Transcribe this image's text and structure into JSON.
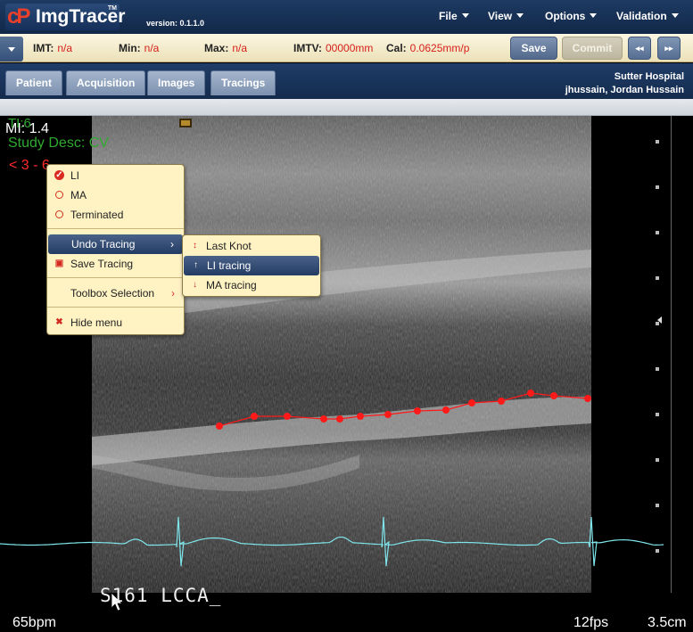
{
  "app": {
    "logo_mark": "cP",
    "logo_text": "ImgTracer",
    "logo_tm": "TM",
    "version": "version: 0.1.1.0",
    "menus": [
      "File",
      "View",
      "Options",
      "Validation"
    ]
  },
  "measurements": {
    "imt": {
      "label": "IMT:",
      "value": "n/a"
    },
    "min": {
      "label": "Min:",
      "value": "n/a"
    },
    "max": {
      "label": "Max:",
      "value": "n/a"
    },
    "imtv": {
      "label": "IMTV:",
      "value": "00000mm"
    },
    "cal": {
      "label": "Cal:",
      "value": "0.0625mm/p"
    }
  },
  "buttons": {
    "save": "Save",
    "commit": "Commit",
    "prev": "◂◂",
    "next": "▸▸"
  },
  "tabs": [
    "Patient",
    "Acquisition",
    "Images",
    "Tracings"
  ],
  "org": {
    "hospital": "Sutter Hospital",
    "user": "jhussain, Jordan Hussain"
  },
  "overlay": {
    "mi": "MI: 1.4",
    "ti": "TI:6",
    "study_desc": "Study Desc: CV",
    "red_code": "< 3 - 6",
    "probe_label": "S161 LCCA_",
    "bpm": "65bpm",
    "fps": "12fps",
    "depth": "3.5cm"
  },
  "context_menu": {
    "items": [
      {
        "label": "LI",
        "icon": "check-icon"
      },
      {
        "label": "MA",
        "icon": "radio-icon"
      },
      {
        "label": "Terminated",
        "icon": "radio-icon"
      },
      {
        "label": "Undo Tracing",
        "icon": "",
        "submenu": true
      },
      {
        "label": "Save Tracing",
        "icon": "save-icon"
      },
      {
        "label": "Toolbox Selection",
        "icon": "",
        "submenu": true
      },
      {
        "label": "Hide menu",
        "icon": "close-icon"
      }
    ]
  },
  "undo_submenu": {
    "items": [
      {
        "label": "Last Knot",
        "icon": "up-down-arrow-icon"
      },
      {
        "label": "LI tracing",
        "icon": "up-arrow-icon"
      },
      {
        "label": "MA tracing",
        "icon": "down-arrow-icon"
      }
    ]
  },
  "colors": {
    "accent_red": "#d8201a",
    "overlay_green": "#2faa2f",
    "trace_red": "#ff1a1a",
    "ecg_cyan": "#7fe6ec"
  }
}
